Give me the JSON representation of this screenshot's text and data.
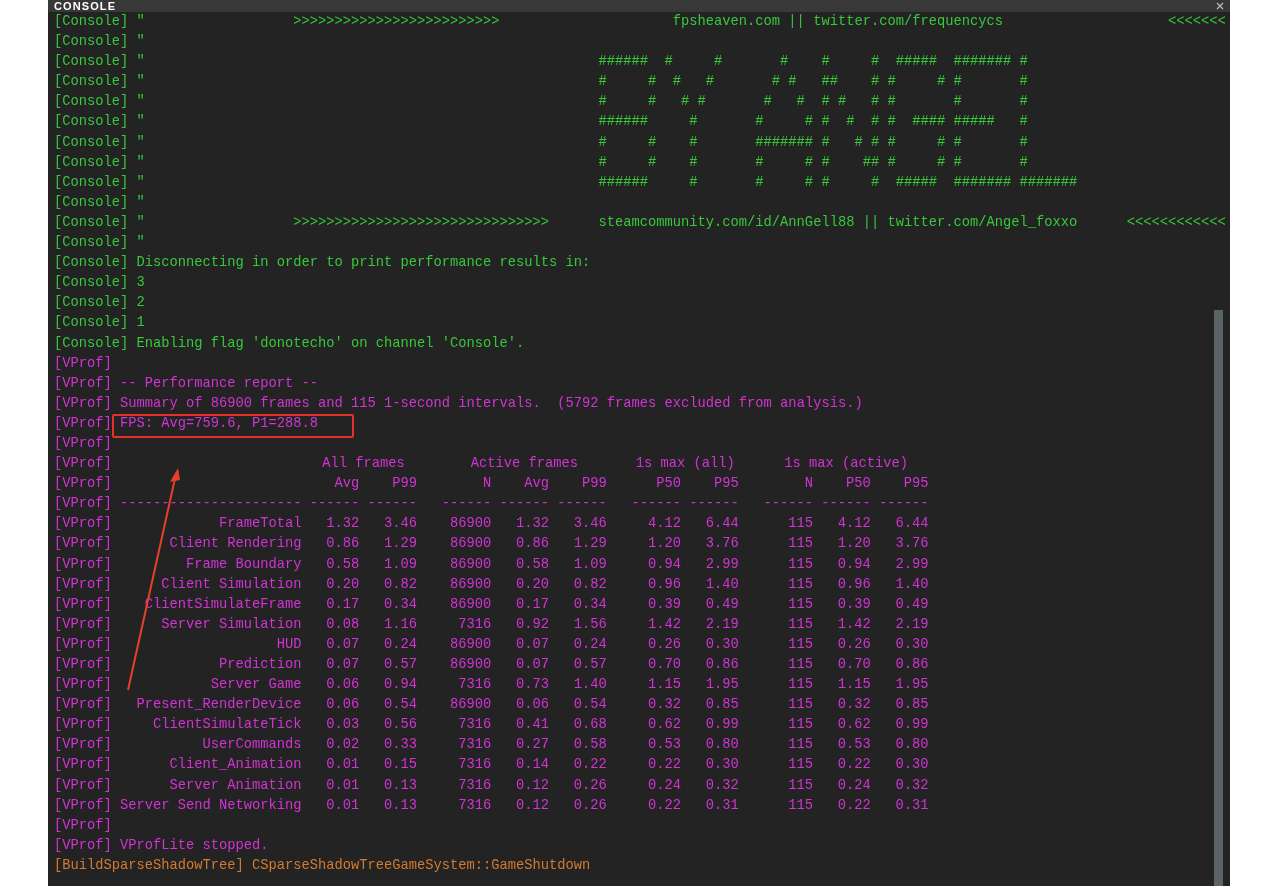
{
  "console": {
    "title": "CONSOLE",
    "lines": [
      {
        "color": "#38c83a",
        "kind": "text",
        "tag": "[Console]",
        "text": "\"                  >>>>>>>>>>>>>>>>>>>>>>>>>                     fpsheaven.com || twitter.com/frequencycs                    <<<<<<<"
      },
      {
        "color": "#38c83a",
        "kind": "text",
        "tag": "[Console]",
        "text": "\""
      },
      {
        "color": "#38c83a",
        "kind": "text",
        "tag": "[Console]",
        "text": "\"                                                       ######  #     #       #    #     #  #####  ####### #"
      },
      {
        "color": "#38c83a",
        "kind": "text",
        "tag": "[Console]",
        "text": "\"                                                       #     #  #   #       # #   ##    # #     # #       #"
      },
      {
        "color": "#38c83a",
        "kind": "text",
        "tag": "[Console]",
        "text": "\"                                                       #     #   # #       #   #  # #   # #       #       #"
      },
      {
        "color": "#38c83a",
        "kind": "text",
        "tag": "[Console]",
        "text": "\"                                                       ######     #       #     # #  #  # #  #### #####   #"
      },
      {
        "color": "#38c83a",
        "kind": "text",
        "tag": "[Console]",
        "text": "\"                                                       #     #    #       ####### #   # # #     # #       #"
      },
      {
        "color": "#38c83a",
        "kind": "text",
        "tag": "[Console]",
        "text": "\"                                                       #     #    #       #     # #    ## #     # #       #"
      },
      {
        "color": "#38c83a",
        "kind": "text",
        "tag": "[Console]",
        "text": "\"                                                       ######     #       #     # #     #  #####  ####### #######"
      },
      {
        "color": "#38c83a",
        "kind": "text",
        "tag": "[Console]",
        "text": "\""
      },
      {
        "color": "#38c83a",
        "kind": "text",
        "tag": "[Console]",
        "text": "\"                  >>>>>>>>>>>>>>>>>>>>>>>>>>>>>>>      steamcommunity.com/id/AnnGell88 || twitter.com/Angel_foxxo      <<<<<<<<<<<<"
      },
      {
        "color": "#38c83a",
        "kind": "text",
        "tag": "[Console]",
        "text": "\""
      },
      {
        "color": "#38c83a",
        "kind": "text",
        "tag": "[Console]",
        "text": "Disconnecting in order to print performance results in:"
      },
      {
        "color": "#38c83a",
        "kind": "text",
        "tag": "[Console]",
        "text": "3"
      },
      {
        "color": "#38c83a",
        "kind": "text",
        "tag": "[Console]",
        "text": "2"
      },
      {
        "color": "#38c83a",
        "kind": "text",
        "tag": "[Console]",
        "text": "1"
      },
      {
        "color": "#38c83a",
        "kind": "text",
        "tag": "[Console]",
        "text": "Enabling flag 'donotecho' on channel 'Console'."
      },
      {
        "color": "#d233d4",
        "kind": "text",
        "tag": "[VProf]"
      },
      {
        "color": "#d233d4",
        "kind": "text",
        "tag": "[VProf]",
        "text": "-- Performance report --"
      },
      {
        "color": "#d233d4",
        "kind": "text",
        "tag": "[VProf]",
        "text": "Summary of 86900 frames and 115 1-second intervals.  (5792 frames excluded from analysis.)"
      },
      {
        "color": "#d233d4",
        "kind": "text",
        "tag": "[VProf]",
        "text": "FPS: Avg=759.6, P1=288.8",
        "highlighted": true
      },
      {
        "color": "#d233d4",
        "kind": "text",
        "tag": "[VProf]"
      },
      {
        "color": "#d233d4",
        "kind": "group_header",
        "tag": "[VProf]",
        "groups": [
          "All frames",
          "Active frames",
          "1s max (all)",
          "1s max (active)"
        ]
      },
      {
        "color": "#d233d4",
        "kind": "column_header",
        "tag": "[VProf]",
        "cells": [
          "Avg",
          "P99",
          "N",
          "Avg",
          "P99",
          "P50",
          "P95",
          "N",
          "P50",
          "P95"
        ]
      },
      {
        "color": "#d233d4",
        "kind": "rule",
        "tag": "[VProf]",
        "name": "----------------------",
        "cells": [
          "------",
          "------",
          "------",
          "------",
          "------",
          "------",
          "------",
          "------",
          "------",
          "------"
        ]
      },
      {
        "color": "#d233d4",
        "kind": "row",
        "tag": "[VProf]",
        "name": "FrameTotal",
        "cells": [
          "1.32",
          "3.46",
          "86900",
          "1.32",
          "3.46",
          "4.12",
          "6.44",
          "115",
          "4.12",
          "6.44"
        ]
      },
      {
        "color": "#d233d4",
        "kind": "row",
        "tag": "[VProf]",
        "name": "Client Rendering",
        "cells": [
          "0.86",
          "1.29",
          "86900",
          "0.86",
          "1.29",
          "1.20",
          "3.76",
          "115",
          "1.20",
          "3.76"
        ]
      },
      {
        "color": "#d233d4",
        "kind": "row",
        "tag": "[VProf]",
        "name": "Frame Boundary",
        "cells": [
          "0.58",
          "1.09",
          "86900",
          "0.58",
          "1.09",
          "0.94",
          "2.99",
          "115",
          "0.94",
          "2.99"
        ]
      },
      {
        "color": "#d233d4",
        "kind": "row",
        "tag": "[VProf]",
        "name": "Client Simulation",
        "cells": [
          "0.20",
          "0.82",
          "86900",
          "0.20",
          "0.82",
          "0.96",
          "1.40",
          "115",
          "0.96",
          "1.40"
        ]
      },
      {
        "color": "#d233d4",
        "kind": "row",
        "tag": "[VProf]",
        "name": "ClientSimulateFrame",
        "cells": [
          "0.17",
          "0.34",
          "86900",
          "0.17",
          "0.34",
          "0.39",
          "0.49",
          "115",
          "0.39",
          "0.49"
        ]
      },
      {
        "color": "#d233d4",
        "kind": "row",
        "tag": "[VProf]",
        "name": "Server Simulation",
        "cells": [
          "0.08",
          "1.16",
          "7316",
          "0.92",
          "1.56",
          "1.42",
          "2.19",
          "115",
          "1.42",
          "2.19"
        ]
      },
      {
        "color": "#d233d4",
        "kind": "row",
        "tag": "[VProf]",
        "name": "HUD",
        "cells": [
          "0.07",
          "0.24",
          "86900",
          "0.07",
          "0.24",
          "0.26",
          "0.30",
          "115",
          "0.26",
          "0.30"
        ]
      },
      {
        "color": "#d233d4",
        "kind": "row",
        "tag": "[VProf]",
        "name": "Prediction",
        "cells": [
          "0.07",
          "0.57",
          "86900",
          "0.07",
          "0.57",
          "0.70",
          "0.86",
          "115",
          "0.70",
          "0.86"
        ]
      },
      {
        "color": "#d233d4",
        "kind": "row",
        "tag": "[VProf]",
        "name": "Server Game",
        "cells": [
          "0.06",
          "0.94",
          "7316",
          "0.73",
          "1.40",
          "1.15",
          "1.95",
          "115",
          "1.15",
          "1.95"
        ]
      },
      {
        "color": "#d233d4",
        "kind": "row",
        "tag": "[VProf]",
        "name": "Present_RenderDevice",
        "cells": [
          "0.06",
          "0.54",
          "86900",
          "0.06",
          "0.54",
          "0.32",
          "0.85",
          "115",
          "0.32",
          "0.85"
        ]
      },
      {
        "color": "#d233d4",
        "kind": "row",
        "tag": "[VProf]",
        "name": "ClientSimulateTick",
        "cells": [
          "0.03",
          "0.56",
          "7316",
          "0.41",
          "0.68",
          "0.62",
          "0.99",
          "115",
          "0.62",
          "0.99"
        ]
      },
      {
        "color": "#d233d4",
        "kind": "row",
        "tag": "[VProf]",
        "name": "UserCommands",
        "cells": [
          "0.02",
          "0.33",
          "7316",
          "0.27",
          "0.58",
          "0.53",
          "0.80",
          "115",
          "0.53",
          "0.80"
        ]
      },
      {
        "color": "#d233d4",
        "kind": "row",
        "tag": "[VProf]",
        "name": "Client_Animation",
        "cells": [
          "0.01",
          "0.15",
          "7316",
          "0.14",
          "0.22",
          "0.22",
          "0.30",
          "115",
          "0.22",
          "0.30"
        ]
      },
      {
        "color": "#d233d4",
        "kind": "row",
        "tag": "[VProf]",
        "name": "Server Animation",
        "cells": [
          "0.01",
          "0.13",
          "7316",
          "0.12",
          "0.26",
          "0.24",
          "0.32",
          "115",
          "0.24",
          "0.32"
        ]
      },
      {
        "color": "#d233d4",
        "kind": "row",
        "tag": "[VProf]",
        "name": "Server Send Networking",
        "cells": [
          "0.01",
          "0.13",
          "7316",
          "0.12",
          "0.26",
          "0.22",
          "0.31",
          "115",
          "0.22",
          "0.31"
        ]
      },
      {
        "color": "#d233d4",
        "kind": "text",
        "tag": "[VProf]"
      },
      {
        "color": "#d233d4",
        "kind": "text",
        "tag": "[VProf]",
        "text": "VProfLite stopped."
      },
      {
        "color": "#d47a30",
        "kind": "text",
        "tag": "[BuildSparseShadowTree]",
        "text": "CSparseShadowTreeGameSystem::GameShutdown"
      }
    ]
  }
}
